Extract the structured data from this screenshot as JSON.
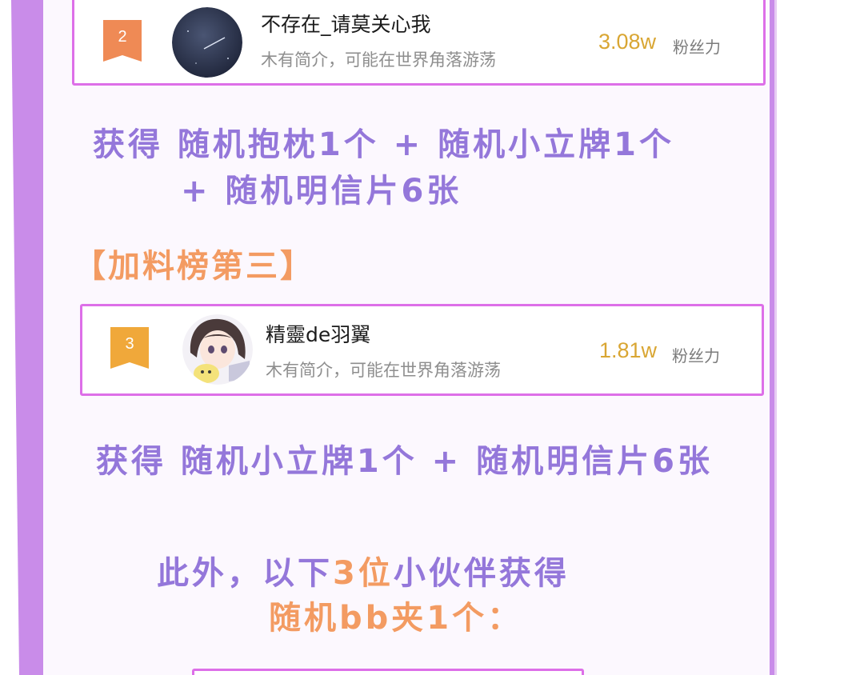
{
  "colors": {
    "frame": "#c98ce9",
    "card_border": "#dd6fe8",
    "prize_text": "#9477da",
    "highlight_text": "#f39b62",
    "fans_number": "#d9a633"
  },
  "entries": [
    {
      "rank": "2",
      "username": "不存在_请莫关心我",
      "bio": "木有简介，可能在世界角落游荡",
      "fans": "3.08w",
      "fans_label": "粉丝力",
      "badge_color": "#ef8a55"
    },
    {
      "rank": "3",
      "username": "精靈de羽翼",
      "bio": "木有简介，可能在世界角落游荡",
      "fans": "1.81w",
      "fans_label": "粉丝力",
      "badge_color": "#f0a83a"
    }
  ],
  "prize_2": {
    "line1": "获得 随机抱枕1个 + 随机小立牌1个",
    "line2": "+ 随机明信片6张"
  },
  "section_3_title": "【加料榜第三】",
  "prize_3": {
    "line1": "获得 随机小立牌1个 + 随机明信片6张"
  },
  "extra": {
    "part1": "此外，以下",
    "highlight": "3位",
    "part2": "小伙伴获得",
    "line2": "随机bb夹1个："
  }
}
